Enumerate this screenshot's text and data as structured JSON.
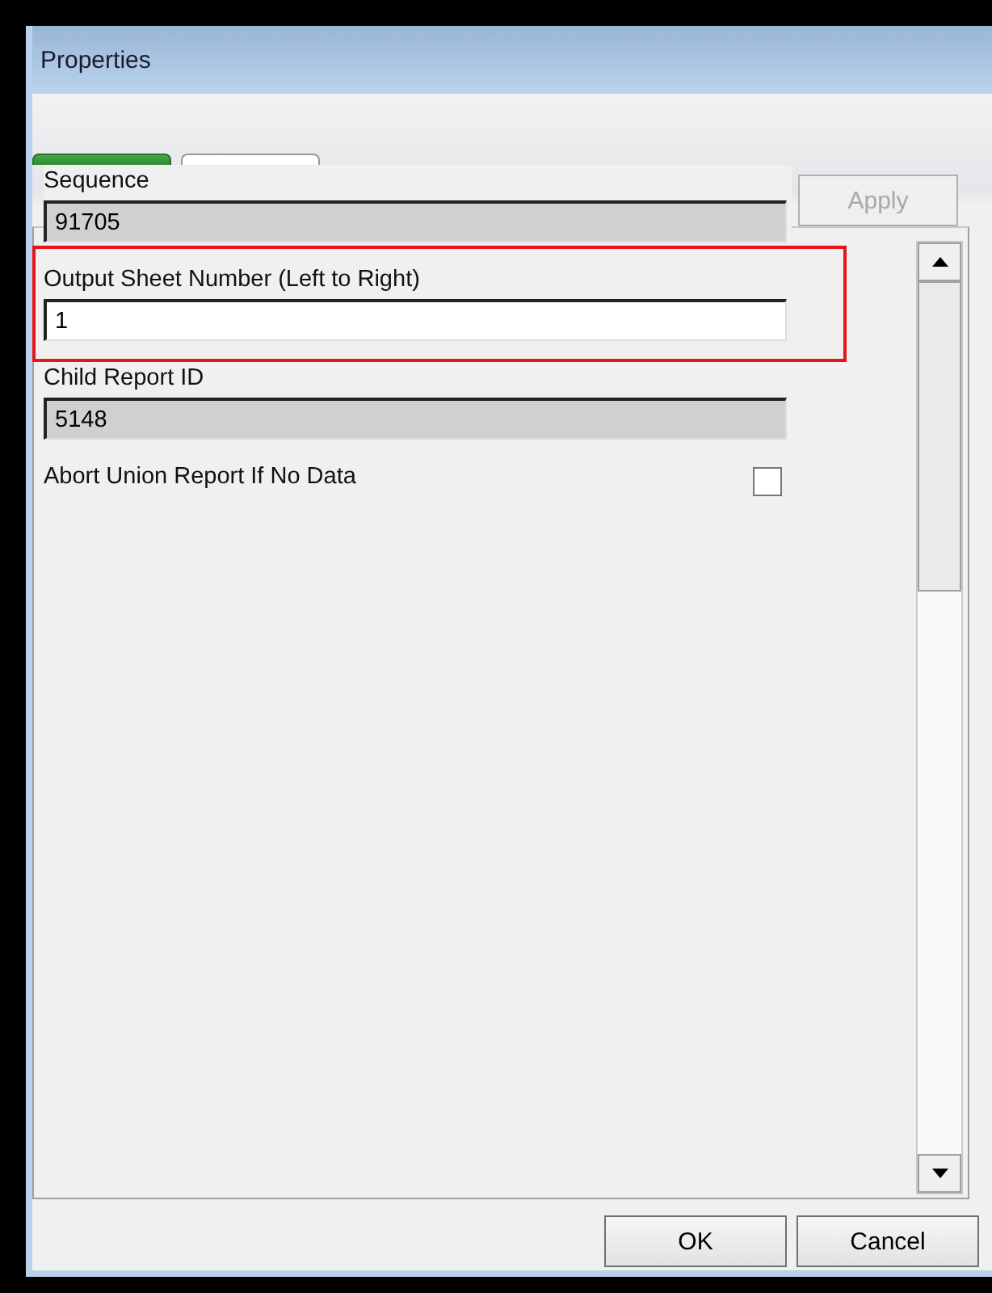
{
  "window": {
    "title": "Properties"
  },
  "tabs": [
    {
      "selected": true
    },
    {
      "selected": false
    }
  ],
  "apply_button": {
    "label": "Apply",
    "disabled": true
  },
  "properties": [
    {
      "kind": "field",
      "label": "Sequence",
      "value": "91705",
      "readonly": true,
      "highlighted": false
    },
    {
      "kind": "field",
      "label": "Output Sheet Number (Left to Right)",
      "value": "1",
      "readonly": false,
      "highlighted": true
    },
    {
      "kind": "field",
      "label": "Child Report ID",
      "value": "5148",
      "readonly": true,
      "highlighted": false
    },
    {
      "kind": "checkbox",
      "label": "Abort Union Report If No Data",
      "checked": false,
      "highlighted": false
    }
  ],
  "buttons": [
    "OK",
    "Cancel"
  ]
}
